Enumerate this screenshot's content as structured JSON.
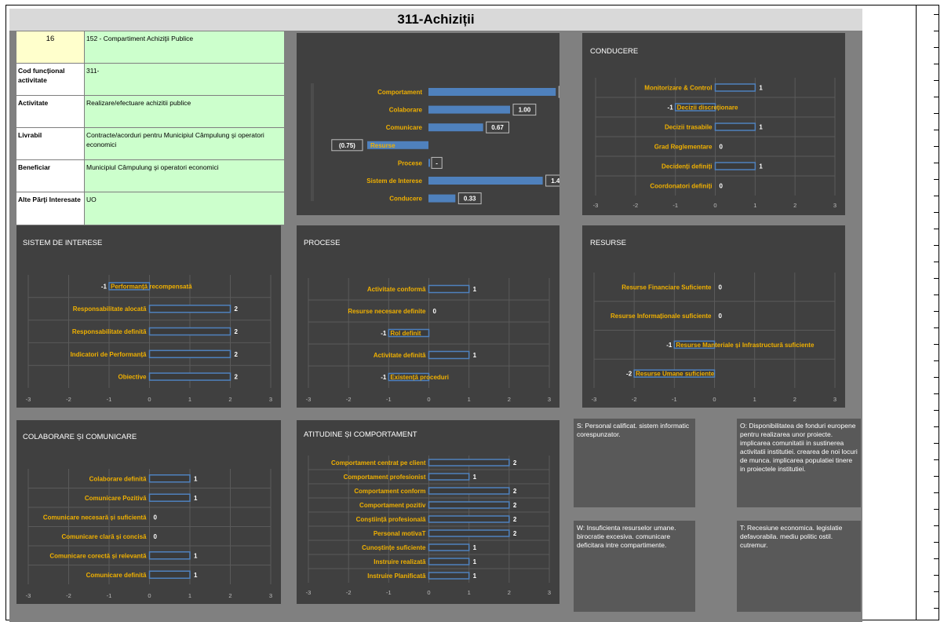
{
  "page": {
    "title": "311-Achiziții"
  },
  "info": {
    "rows": [
      {
        "label": "16",
        "value": "152 - Compartiment Achiziţii Publice"
      },
      {
        "label": "Cod funcțional activitate",
        "value": "311-"
      },
      {
        "label": "Activitate",
        "value": "Realizare/efectuare achizitii publice"
      },
      {
        "label": "Livrabil",
        "value": "Contracte/acorduri pentru Municipiul Câmpulung şi operatori economici"
      },
      {
        "label": "Beneficiar",
        "value": "Municipiul Câmpulung şi operatori economici"
      },
      {
        "label": "Alte Părţi Interesate",
        "value": "UO"
      }
    ]
  },
  "swot": {
    "s": "S: Personal calificat. sistem informatic corespunzator.",
    "o": "O: Disponibilitatea de fonduri europene pentru realizarea unor proiecte. implicarea comunitatii in sustinerea activitatii institutiei. crearea de noi locuri de munca. implicarea populatiei tinere in proiectele institutiei.",
    "w": "W: Insuficienta resurselor umane. birocratie excesiva. comunicare deficitara intre compartimente.",
    "t": "T: Recesiune economica. legislatie defavorabila. mediu politic ostil. cutremur."
  },
  "colors": {
    "bar_fill": "#4f81bd",
    "bar_outline": "#4f81bd",
    "label": "#f0b000",
    "panel": "#404040"
  },
  "chart_data": [
    {
      "type": "bar",
      "title": "",
      "categories": [
        "Comportament",
        "Colaborare",
        "Comunicare",
        "Resurse",
        "Procese",
        "Sistem de Interese",
        "Conducere"
      ],
      "values": [
        1.56,
        1.0,
        0.67,
        -0.75,
        0,
        1.4,
        0.33
      ],
      "data_labels": [
        "1.56",
        "1.00",
        "0.67",
        "(0.75)",
        "-",
        "1.40",
        "0.33"
      ],
      "orientation": "horizontal"
    },
    {
      "type": "bar",
      "title": "CONDUCERE",
      "categories": [
        "Monitorizare & Control",
        "Decizii discreționare",
        "Decizii trasabile",
        "Grad Reglementare",
        "Decidenți definiți",
        "Coordonatori definiți"
      ],
      "values": [
        1,
        -1,
        1,
        0,
        1,
        0
      ],
      "xlim": [
        -3,
        3
      ],
      "ticks": [
        "-3",
        "-2",
        "-1",
        "0",
        "1",
        "2",
        "3"
      ],
      "orientation": "horizontal"
    },
    {
      "type": "bar",
      "title": "SISTEM DE INTERESE",
      "categories": [
        "Performanță recompensată",
        "Responsabilitate alocată",
        "Responsabilitate definită",
        "Indicatori de Performanță",
        "Obiective"
      ],
      "values": [
        -1,
        2,
        2,
        2,
        2
      ],
      "xlim": [
        -3,
        3
      ],
      "ticks": [
        "-3",
        "-2",
        "-1",
        "0",
        "1",
        "2",
        "3"
      ],
      "orientation": "horizontal"
    },
    {
      "type": "bar",
      "title": "PROCESE",
      "categories": [
        "Activitate conformă",
        "Resurse necesare definite",
        "Rol definit",
        "Activitate definită",
        "Existență proceduri"
      ],
      "values": [
        1,
        0,
        -1,
        1,
        -1
      ],
      "xlim": [
        -3,
        3
      ],
      "ticks": [
        "-3",
        "-2",
        "-1",
        "0",
        "1",
        "2",
        "3"
      ],
      "orientation": "horizontal"
    },
    {
      "type": "bar",
      "title": "RESURSE",
      "categories": [
        "Resurse Financiare Suficiente",
        "Resurse Informaționale suficiente",
        "Resurse Manteriale și Infrastructură suficiente",
        "Resurse Umane suficiente"
      ],
      "values": [
        0,
        0,
        -1,
        -2
      ],
      "xlim": [
        -3,
        3
      ],
      "ticks": [
        "-3",
        "-2",
        "-1",
        "0",
        "1",
        "2",
        "3"
      ],
      "orientation": "horizontal"
    },
    {
      "type": "bar",
      "title": "COLABORARE ȘI COMUNICARE",
      "categories": [
        "Colaborare definită",
        "Comunicare Pozitivă",
        "Comunicare necesară și suficientă",
        "Comunicare clară și concisă",
        "Comunicare corectă și relevantă",
        "Comunicare definită"
      ],
      "values": [
        1,
        1,
        0,
        0,
        1,
        1
      ],
      "xlim": [
        -3,
        3
      ],
      "ticks": [
        "-3",
        "-2",
        "-1",
        "0",
        "1",
        "2",
        "3"
      ],
      "orientation": "horizontal"
    },
    {
      "type": "bar",
      "title": "ATITUDINE ȘI COMPORTAMENT",
      "categories": [
        "Comportament centrat pe client",
        "Comportament profesionist",
        "Comportament conform",
        "Comportament pozitiv",
        "Conștiință profesională",
        "Personal motivaT",
        "Cunoștințe suficiente",
        "Instruire realizată",
        "Instruire Planificată"
      ],
      "values": [
        2,
        1,
        2,
        2,
        2,
        2,
        1,
        1,
        1
      ],
      "xlim": [
        -3,
        3
      ],
      "ticks": [
        "-3",
        "-2",
        "-1",
        "0",
        "1",
        "2",
        "3"
      ],
      "orientation": "horizontal"
    }
  ]
}
